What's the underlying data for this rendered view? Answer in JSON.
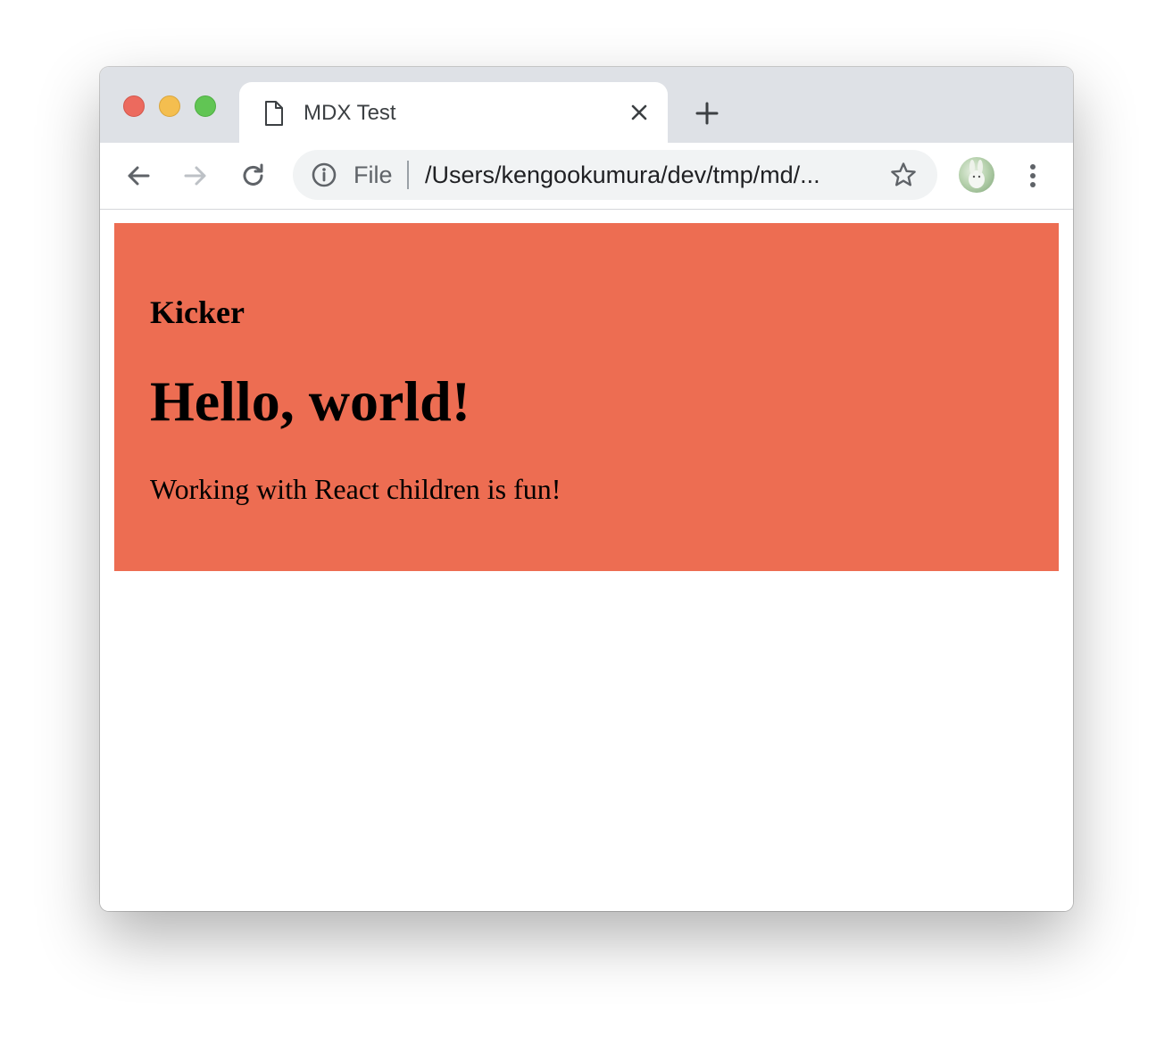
{
  "browser": {
    "window_controls": [
      "close",
      "minimize",
      "zoom"
    ],
    "tab": {
      "title": "MDX Test",
      "icon": "document-icon",
      "close_icon": "close-icon"
    },
    "new_tab_icon": "plus-icon",
    "toolbar": {
      "back_icon": "arrow-left-icon",
      "forward_icon": "arrow-right-icon",
      "reload_icon": "reload-icon",
      "address": {
        "info_icon": "info-icon",
        "scheme": "File",
        "url": "/Users/kengookumura/dev/tmp/md/...",
        "bookmark_icon": "star-icon"
      },
      "profile_icon": "avatar",
      "menu_icon": "kebab-menu-icon"
    }
  },
  "page": {
    "background_color": "#ed6d52",
    "kicker": "Kicker",
    "headline": "Hello, world!",
    "body": "Working with React children is fun!"
  }
}
